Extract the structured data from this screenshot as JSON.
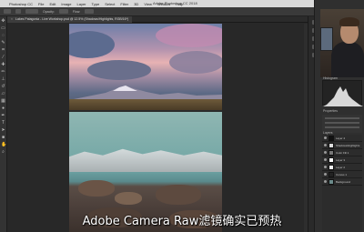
{
  "menubar": {
    "apple": "",
    "items": [
      "Photoshop CC",
      "File",
      "Edit",
      "Image",
      "Layer",
      "Type",
      "Select",
      "Filter",
      "3D",
      "View",
      "Window",
      "Help"
    ],
    "window_title": "Adobe Photoshop CC 2018"
  },
  "options_bar": {
    "opacity_label": "Opacity:",
    "flow_label": "Flow:"
  },
  "document_tab": {
    "name": "Lakes Patagonia - Live Workshop.psd @ 12.5% (Shadows/Highlights, RGB/16*)",
    "close": "×"
  },
  "panels": {
    "histogram_label": "Histogram",
    "properties_label": "Properties",
    "layers_label": "Layers",
    "layers": [
      {
        "name": "Layer 4"
      },
      {
        "name": "Shadows/Highlights"
      },
      {
        "name": "Color Fill 1"
      },
      {
        "name": "Layer 3"
      },
      {
        "name": "Layer 2"
      },
      {
        "name": "Curves 1"
      },
      {
        "name": "Background"
      }
    ]
  },
  "subtitle": {
    "text": "Adobe Camera Raw滤镜确实已预热"
  },
  "colors": {
    "accent": "#3b3b3b",
    "canvas": "#282828",
    "menubar": "#d9d9d9"
  }
}
